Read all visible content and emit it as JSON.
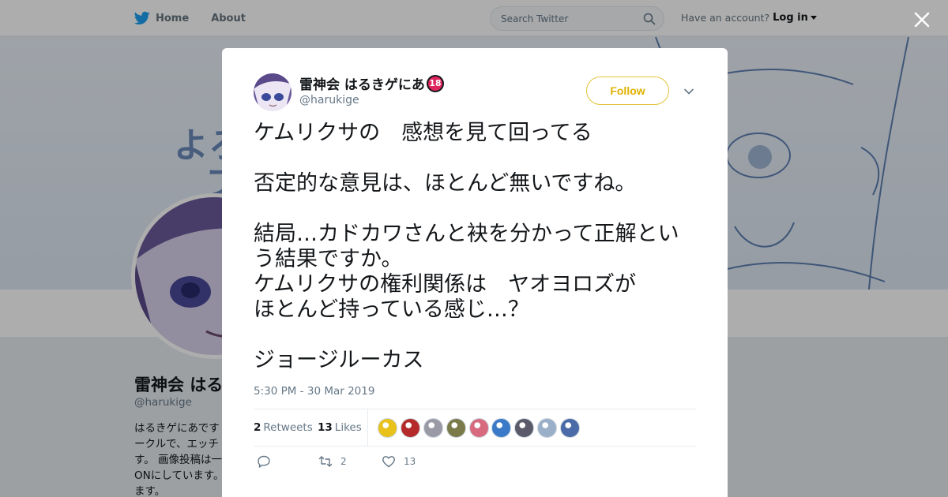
{
  "nav": {
    "home_label": "Home",
    "about_label": "About",
    "search_placeholder": "Search Twitter",
    "account_text": "Have an account?",
    "login_label": "Log in"
  },
  "profile": {
    "name": "雷神会 はる",
    "handle": "@harukige",
    "bio_lines": [
      "はるきゲにあです",
      "ークルで、エッチ",
      "す。 画像投稿は一",
      "ONにしています。",
      "ます。"
    ]
  },
  "banner": {
    "text_1": "よろ",
    "text_2": "フ"
  },
  "tweet": {
    "author_name": "雷神会 はるきゲにあ",
    "author_badge": "18",
    "author_handle": "@harukige",
    "follow_label": "Follow",
    "lines": [
      "ケムリクサの　感想を見て回ってる",
      "",
      "否定的な意見は、ほとんど無いですね。",
      "",
      "結局…カドカワさんと袂を分かって正解とい",
      "う結果ですか。",
      "ケムリクサの権利関係は　ヤオヨロズが",
      "ほとんど持っている感じ…？",
      "",
      "ジョージルーカス"
    ],
    "timestamp": "5:30 PM - 30 Mar 2019",
    "retweets_count": "2",
    "retweets_label": "Retweets",
    "likes_count": "13",
    "likes_label": "Likes",
    "likers_colors": [
      "#e8c21a",
      "#b52a2a",
      "#9a9aa6",
      "#7a7a4a",
      "#d86a80",
      "#3a7ac8",
      "#5a5a6a",
      "#9ab0c8",
      "#4a6aa8"
    ],
    "action_retweet_count": "2",
    "action_like_count": "13"
  },
  "icons": {
    "bird": "twitter-bird-icon",
    "search": "search-icon",
    "close": "close-icon",
    "chevron": "chevron-down-icon",
    "reply": "reply-icon",
    "retweet": "retweet-icon",
    "like": "heart-icon"
  },
  "colors": {
    "brand_blue": "#1da1f2",
    "follow_accent": "#e0b200",
    "badge_red": "#e0245e"
  }
}
